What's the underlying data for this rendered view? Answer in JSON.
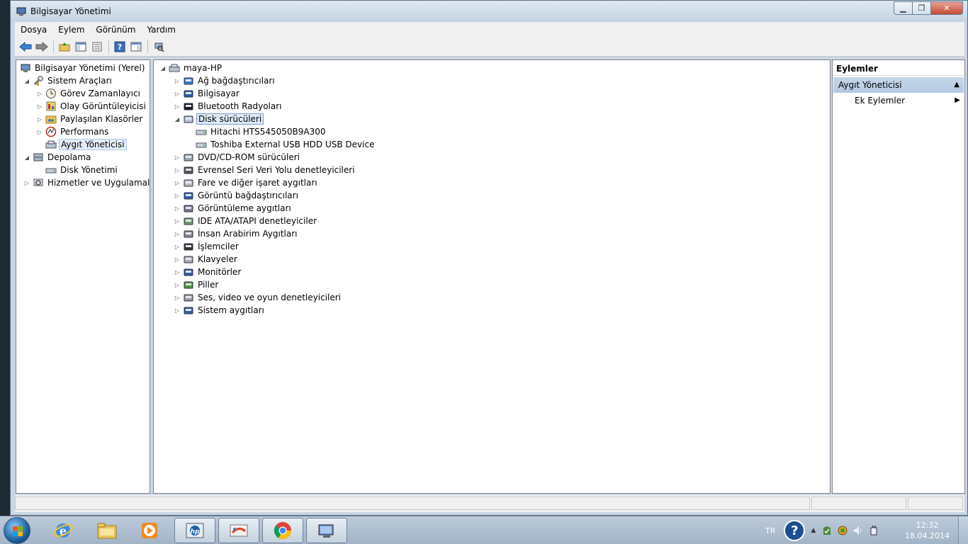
{
  "window": {
    "title": "Bilgisayar Yönetimi"
  },
  "menu": [
    "Dosya",
    "Eylem",
    "Görünüm",
    "Yardım"
  ],
  "left_tree": {
    "root": "Bilgisayar Yönetimi (Yerel)",
    "system_tools": "Sistem Araçları",
    "task_scheduler": "Görev Zamanlayıcı",
    "event_viewer": "Olay Görüntüleyicisi",
    "shared_folders": "Paylaşılan Klasörler",
    "performance": "Performans",
    "device_manager": "Aygıt Yöneticisi",
    "storage": "Depolama",
    "disk_management": "Disk Yönetimi",
    "services": "Hizmetler ve Uygulamalar"
  },
  "device_tree": {
    "root": "maya-HP",
    "categories": [
      "Ağ bağdaştırıcıları",
      "Bilgisayar",
      "Bluetooth Radyoları",
      "Disk sürücüleri",
      "DVD/CD-ROM sürücüleri",
      "Evrensel Seri Veri Yolu denetleyicileri",
      "Fare ve diğer işaret aygıtları",
      "Görüntü bağdaştırıcıları",
      "Görüntüleme aygıtları",
      "IDE ATA/ATAPI denetleyiciler",
      "İnsan Arabirim Aygıtları",
      "İşlemciler",
      "Klavyeler",
      "Monitörler",
      "Piller",
      "Ses, video ve oyun denetleyicileri",
      "Sistem aygıtları"
    ],
    "disk_children": [
      "Hitachi HTS545050B9A300",
      "Toshiba External USB HDD USB Device"
    ]
  },
  "actions": {
    "header": "Eylemler",
    "group": "Aygıt Yöneticisi",
    "item": "Ek Eylemler"
  },
  "taskbar": {
    "language": "TR",
    "time": "12:32",
    "date": "18.04.2014"
  },
  "colors": {
    "selection": "#dce9f8",
    "actions_group": "#c6d7ea",
    "titlebar": "#c4d3e2"
  }
}
